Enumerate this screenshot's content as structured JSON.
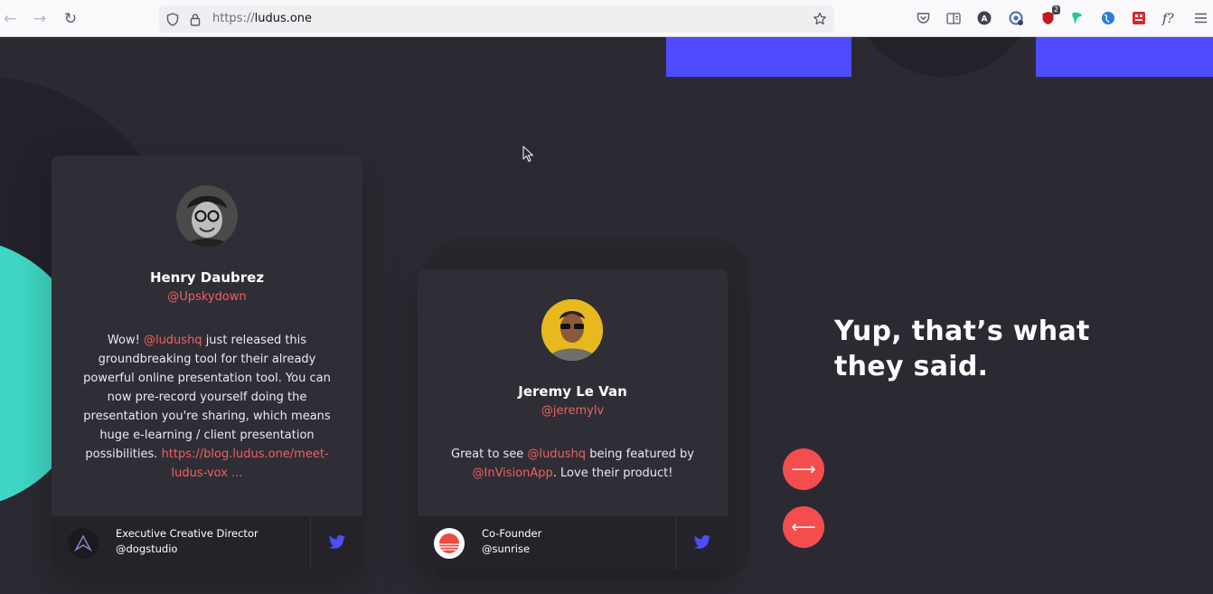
{
  "browser": {
    "url_protocol": "https://",
    "url_host": "ludus.one",
    "extension_badge": "2"
  },
  "testimonials": [
    {
      "name": "Henry Daubrez",
      "handle": "@Upskydown",
      "quote_parts": [
        "Wow! ",
        "@ludushq",
        " just released this groundbreaking tool for their already powerful online presentation tool. You can now pre-record yourself doing the presentation you're sharing, which means huge e-learning / client presentation possibilities. ",
        "https://blog.ludus.one/meet-ludus-vox ..."
      ],
      "role": "Executive Creative Director",
      "company": "@dogstudio"
    },
    {
      "name": "Jeremy Le Van",
      "handle": "@jeremylv",
      "quote_parts": [
        "Great to see ",
        "@ludushq",
        " being featured by ",
        "@InVisionApp",
        ". Love their product!"
      ],
      "role": "Co-Founder",
      "company": "@sunrise"
    }
  ],
  "headline": "Yup, that’s what they said.",
  "controls": {
    "next_glyph": "⟶",
    "prev_glyph": "⟵"
  },
  "colors": {
    "accent": "#f0605f",
    "button": "#f44d4d",
    "background": "#2b2a32",
    "card": "#2f2e36",
    "card_footer": "#24232a",
    "blue": "#4f4bff",
    "teal": "#3fd6c4",
    "twitter": "#4f4bff"
  }
}
